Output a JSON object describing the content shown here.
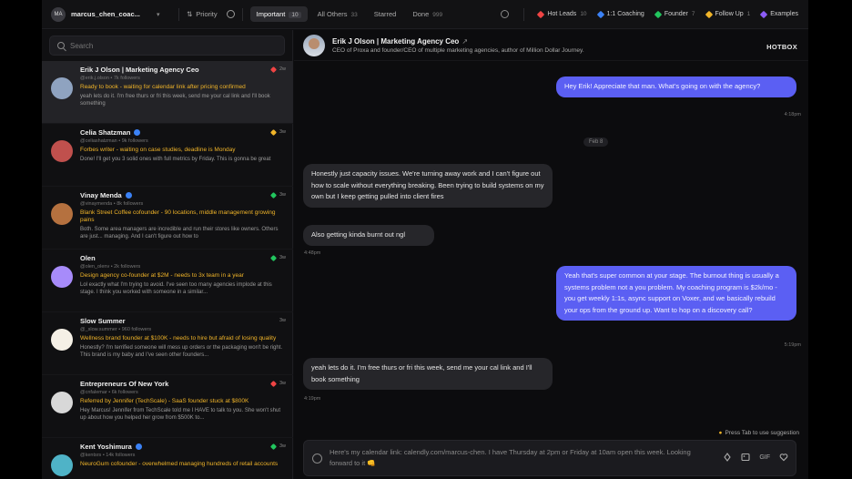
{
  "topbar": {
    "avatar_initials": "MA",
    "account": "marcus_chen_coac...",
    "priority": "Priority",
    "tabs": [
      {
        "label": "Important",
        "count": "10"
      },
      {
        "label": "All Others",
        "count": "33"
      },
      {
        "label": "Starred",
        "count": ""
      },
      {
        "label": "Done",
        "count": "999"
      }
    ],
    "tags": [
      {
        "label": "Hot Leads",
        "count": "10",
        "color": "#ef4444"
      },
      {
        "label": "1:1 Coaching",
        "count": "",
        "color": "#3b82f6"
      },
      {
        "label": "Founder",
        "count": "7",
        "color": "#22c55e"
      },
      {
        "label": "Follow Up",
        "count": "1",
        "color": "#f0b429"
      },
      {
        "label": "Examples",
        "count": "",
        "color": "#8b5cf6"
      }
    ]
  },
  "sidebar": {
    "search_placeholder": "Search",
    "conversations": [
      {
        "name": "Erik J Olson | Marketing Agency Ceo",
        "meta": "@erik.j.olson  •  7k followers",
        "highlight": "Ready to book - waiting for calendar link after pricing confirmed",
        "preview": "yeah lets do it. I'm free thurs or fri this week, send me your cal link and I'll book something",
        "time": "2w",
        "flag": "#ef4444",
        "avatar": "#8fa3c0",
        "verified": false
      },
      {
        "name": "Celia Shatzman",
        "meta": "@celiashatzman  •  9k followers",
        "highlight": "Forbes writer - waiting on case studies, deadline is Monday",
        "preview": "Done! I'll get you 3 solid ones with full metrics by Friday. This is gonna be great",
        "time": "3w",
        "flag": "#f0b429",
        "avatar": "#c0504d",
        "verified": true
      },
      {
        "name": "Vinay Menda",
        "meta": "@vinaymenda  •  8k followers",
        "highlight": "Blank Street Coffee cofounder - 90 locations, middle management growing pains",
        "preview": "Both. Some area managers are incredible and run their stores like owners. Others are just... managing. And I can't figure out how to",
        "time": "3w",
        "flag": "#22c55e",
        "avatar": "#b5713f",
        "verified": true
      },
      {
        "name": "Olen",
        "meta": "@olen_olenv  •  2k followers",
        "highlight": "Design agency co-founder at $2M - needs to 3x team in a year",
        "preview": "Lol exactly what I'm trying to avoid. I've seen too many agencies implode at this stage. I think you worked with someone in a similar...",
        "time": "3w",
        "flag": "#22c55e",
        "avatar": "#a78bfa",
        "verified": false
      },
      {
        "name": "Slow Summer",
        "meta": "@_slow.summer  •  960 followers",
        "highlight": "Wellness brand founder at $100K - needs to hire but afraid of losing quality",
        "preview": "Honestly? I'm terrified someone will mess up orders or the packaging won't be right. This brand is my baby and I've seen other founders...",
        "time": "3w",
        "flag": "",
        "avatar": "#f5f0e6",
        "verified": false
      },
      {
        "name": "Entrepreneurs Of New York",
        "meta": "@cnfalemar  •  6k followers",
        "highlight": "Referred by Jennifer (TechScale) - SaaS founder stuck at $800K",
        "preview": "Hey Marcus! Jennifer from TechScale told me I HAVE to talk to you. She won't shut up about how you helped her grow from $500K to...",
        "time": "3w",
        "flag": "#ef4444",
        "avatar": "#d8d8d8",
        "verified": false
      },
      {
        "name": "Kent Yoshimura",
        "meta": "@kentsrs  •  14k followers",
        "highlight": "NeuroGum cofounder - overwhelmed managing hundreds of retail accounts",
        "preview": "",
        "time": "3w",
        "flag": "#22c55e",
        "avatar": "#4fb3c7",
        "verified": true
      }
    ]
  },
  "chat": {
    "contact_name": "Erik J Olson | Marketing Agency Ceo",
    "contact_bio": "CEO of Proxa and founder/CEO of multiple marketing agencies, author of Million Dollar Journey.",
    "brand": "HOTBOX",
    "date_divider": "Feb 8",
    "messages": [
      {
        "dir": "out",
        "text": "Hey Erik! Appreciate that man. What's going on with the agency?",
        "time": "4:18pm"
      },
      {
        "dir": "in",
        "text": "Honestly just capacity issues. We're turning away work and I can't figure out how to scale without everything breaking. Been trying to build systems on my own but I keep getting pulled into client fires",
        "time": ""
      },
      {
        "dir": "in",
        "text": "Also getting kinda burnt out ngl",
        "time": "4:48pm"
      },
      {
        "dir": "out",
        "text": "Yeah that's super common at your stage. The burnout thing is usually a systems problem not a you problem. My coaching program is $2k/mo - you get weekly 1:1s, async support on Voxer, and we basically rebuild your ops from the ground up. Want to hop on a discovery call?",
        "time": "5:19pm"
      },
      {
        "dir": "in",
        "text": "yeah lets do it. I'm free thurs or fri this week, send me your cal link and I'll book something",
        "time": "4:19pm"
      }
    ],
    "suggestion_hint": "Press Tab to use suggestion",
    "composer_text": "Here's my calendar link: calendly.com/marcus-chen. I have Thursday at 2pm or Friday at 10am open this week. Looking forward to it 👊",
    "gif_label": "GIF"
  }
}
